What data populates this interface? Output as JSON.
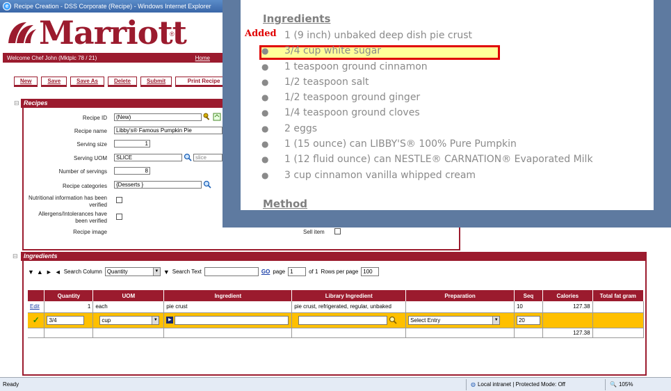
{
  "window": {
    "title": "Recipe Creation - DSS Corporate (Recipe) - Windows Internet Explorer",
    "brand": "Marriott",
    "reg_mark": "®",
    "welcome": "Welcome Chef John (Mktplc 78 / 21)",
    "home_link": "Home"
  },
  "toolbar_buttons": [
    "New",
    "Save",
    "Save As",
    "Delete",
    "Submit",
    "Print Recipe"
  ],
  "recipes_section": {
    "header": "Recipes",
    "fields": {
      "recipe_id_label": "Recipe ID",
      "recipe_id_value": "(New)",
      "recipe_name_label": "Recipe name",
      "recipe_name_value": "Libby's® Famous Pumpkin Pie",
      "serving_size_label": "Serving size",
      "serving_size_value": "1",
      "serving_uom_label": "Serving UOM",
      "serving_uom_value": "SLICE",
      "serving_uom_alt": "slice",
      "num_servings_label": "Number of servings",
      "num_servings_value": "8",
      "recipe_categories_label": "Recipe categories",
      "recipe_categories_value": "{Desserts }",
      "nutrition_label_1": "Nutritional information has been",
      "nutrition_label_2": "verified",
      "allergen_label_1": "Allergens/Intolerances have",
      "allergen_label_2": "been verified",
      "recipe_image_label": "Recipe image",
      "sell_item_label": "Sell item"
    }
  },
  "ingredients_section": {
    "header": "Ingredients",
    "search_column_label": "Search Column",
    "search_column_value": "Quantity",
    "search_text_label": "Search Text",
    "go_label": "GO",
    "page_label": "page",
    "page_value": "1",
    "of_label": "of 1",
    "rows_per_page_label": "Rows per page",
    "rows_per_page_value": "100",
    "columns": [
      "",
      "Quantity",
      "UOM",
      "Ingredient",
      "Library Ingredient",
      "Preparation",
      "Seq",
      "Calories",
      "Total fat gram"
    ],
    "rows": [
      {
        "action": "Edit",
        "quantity": "1",
        "uom": "each",
        "ingredient": "pie crust",
        "library_ingredient": "pie crust, refrigerated, regular, unbaked",
        "preparation": "",
        "seq": "10",
        "calories": "127.38",
        "total_fat": ""
      }
    ],
    "edit_row": {
      "quantity": "3/4",
      "uom": "cup",
      "preparation": "Select Entry",
      "seq": "20"
    },
    "total_calories": "127.38"
  },
  "overlay": {
    "title": "Ingredients",
    "added_label": "Added",
    "items": [
      "1 (9 inch) unbaked deep dish pie crust",
      "3/4 cup white sugar",
      "1 teaspoon ground cinnamon",
      "1/2 teaspoon salt",
      "1/2 teaspoon ground ginger",
      "1/4 teaspoon ground cloves",
      "2 eggs",
      "1 (15 ounce) can LIBBY'S® 100% Pure Pumpkin",
      "1 (12 fluid ounce) can NESTLE® CARNATION® Evaporated Milk",
      "3 cup cinnamon vanilla whipped cream"
    ],
    "highlighted_index": 1,
    "method_title": "Method"
  },
  "statusbar": {
    "ready": "Ready",
    "zone": "Local intranet | Protected Mode: Off",
    "zoom": "105%"
  },
  "colors": {
    "brand": "#9b1b2e",
    "edit_row": "#ffc000",
    "highlight_border": "#e00000",
    "highlight_fill": "#ffff9a"
  }
}
